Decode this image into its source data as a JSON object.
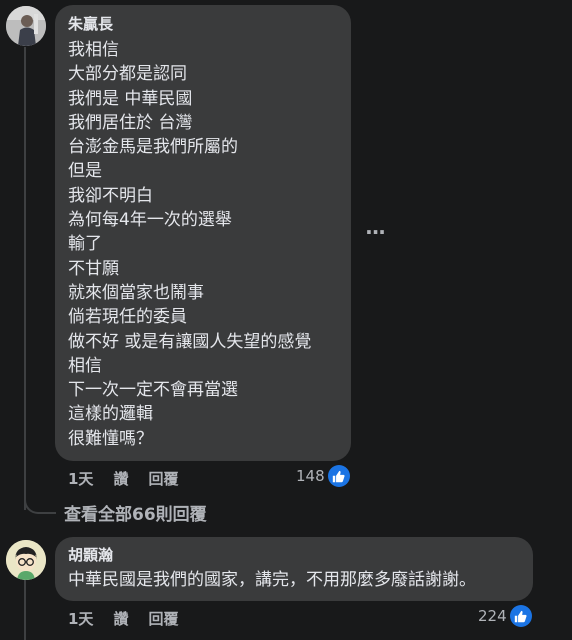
{
  "comment1": {
    "author": "朱贏長",
    "lines": [
      "我相信",
      "大部分都是認同",
      "我們是 中華民國",
      "我們居住於 台灣",
      "台澎金馬是我們所屬的",
      "但是",
      "我卻不明白",
      "為何每4年一次的選舉",
      "輸了",
      "不甘願",
      "就來個當家也鬧事",
      "倘若現任的委員",
      "做不好 或是有讓國人失望的感覺",
      "相信",
      "下一次一定不會再當選",
      "這樣的邏輯",
      "很難懂嗎？"
    ],
    "time": "1天",
    "like_label": "讚",
    "reply_label": "回覆",
    "reaction_count": "148"
  },
  "thread": {
    "view_replies": "查看全部66則回覆"
  },
  "comment2": {
    "author": "胡顥瀚",
    "text": "中華民國是我們的國家，講完，不用那麼多廢話謝謝。",
    "time": "1天",
    "like_label": "讚",
    "reply_label": "回覆",
    "reaction_count": "224"
  },
  "colors": {
    "background": "#18191a",
    "bubble": "#3a3b3c",
    "text": "#e4e6eb",
    "secondary": "#b0b3b8",
    "like_blue": "#1b74e4"
  },
  "icons": {
    "more": "more-options-icon",
    "like": "thumbs-up-icon"
  }
}
